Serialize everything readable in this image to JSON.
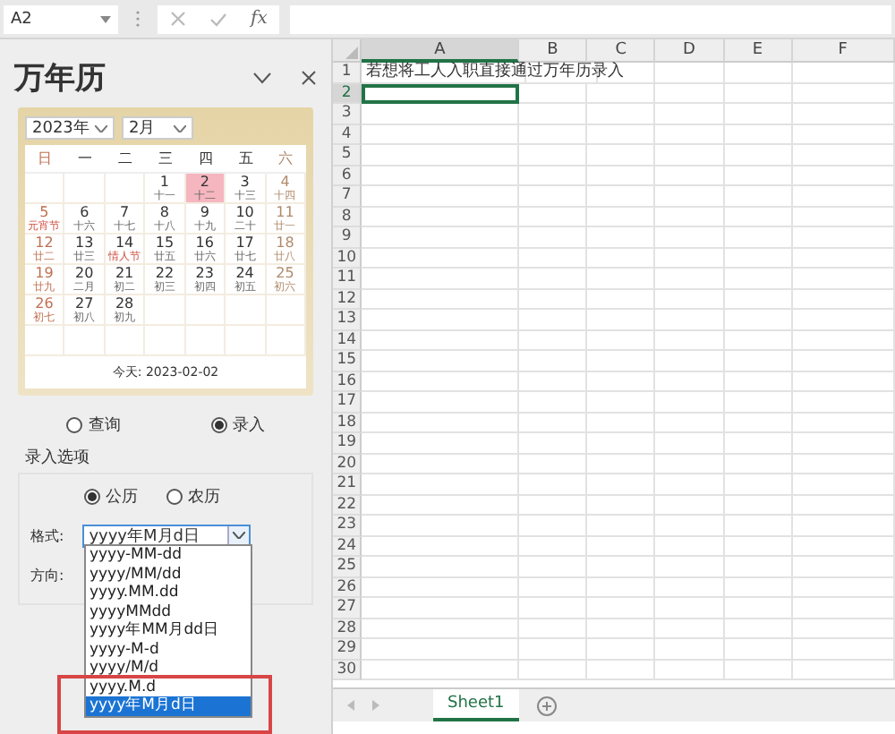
{
  "name_box": {
    "value": "A2"
  },
  "formula_bar": {
    "function_label": "fx"
  },
  "pane": {
    "title": "万年历",
    "year": "2023年",
    "month": "2月",
    "weekdays": [
      {
        "label": "日"
      },
      {
        "label": "一"
      },
      {
        "label": "二"
      },
      {
        "label": "三"
      },
      {
        "label": "四"
      },
      {
        "label": "五"
      },
      {
        "label": "六"
      }
    ],
    "weeks": [
      [
        {
          "day": "1",
          "lunar": "十一",
          "holiday": false,
          "selected": false
        },
        {
          "day": "2",
          "lunar": "十二",
          "holiday": false,
          "selected": true
        },
        {
          "day": "3",
          "lunar": "十三",
          "holiday": false,
          "selected": false
        },
        {
          "day": "4",
          "lunar": "十四",
          "holiday": false,
          "selected": false
        }
      ],
      [
        {
          "day": "5",
          "lunar": "元宵节",
          "holiday": true,
          "selected": false
        },
        {
          "day": "6",
          "lunar": "十六",
          "holiday": false,
          "selected": false
        },
        {
          "day": "7",
          "lunar": "十七",
          "holiday": false,
          "selected": false
        },
        {
          "day": "8",
          "lunar": "十八",
          "holiday": false,
          "selected": false
        },
        {
          "day": "9",
          "lunar": "十九",
          "holiday": false,
          "selected": false
        },
        {
          "day": "10",
          "lunar": "二十",
          "holiday": false,
          "selected": false
        },
        {
          "day": "11",
          "lunar": "廿一",
          "holiday": false,
          "selected": false
        }
      ],
      [
        {
          "day": "12",
          "lunar": "廿二",
          "holiday": false,
          "selected": false
        },
        {
          "day": "13",
          "lunar": "廿三",
          "holiday": false,
          "selected": false
        },
        {
          "day": "14",
          "lunar": "情人节",
          "holiday": true,
          "selected": false
        },
        {
          "day": "15",
          "lunar": "廿五",
          "holiday": false,
          "selected": false
        },
        {
          "day": "16",
          "lunar": "廿六",
          "holiday": false,
          "selected": false
        },
        {
          "day": "17",
          "lunar": "廿七",
          "holiday": false,
          "selected": false
        },
        {
          "day": "18",
          "lunar": "廿八",
          "holiday": false,
          "selected": false
        }
      ],
      [
        {
          "day": "19",
          "lunar": "廿九",
          "holiday": false,
          "selected": false
        },
        {
          "day": "20",
          "lunar": "二月",
          "holiday": false,
          "selected": false
        },
        {
          "day": "21",
          "lunar": "初二",
          "holiday": false,
          "selected": false
        },
        {
          "day": "22",
          "lunar": "初三",
          "holiday": false,
          "selected": false
        },
        {
          "day": "23",
          "lunar": "初四",
          "holiday": false,
          "selected": false
        },
        {
          "day": "24",
          "lunar": "初五",
          "holiday": false,
          "selected": false
        },
        {
          "day": "25",
          "lunar": "初六",
          "holiday": false,
          "selected": false
        }
      ],
      [
        {
          "day": "26",
          "lunar": "初七",
          "holiday": false,
          "selected": false
        },
        {
          "day": "27",
          "lunar": "初八",
          "holiday": false,
          "selected": false
        },
        {
          "day": "28",
          "lunar": "初九",
          "holiday": false,
          "selected": false
        }
      ]
    ],
    "today": "今天:  2023-02-02",
    "modes": [
      {
        "label": "查询",
        "selected": false
      },
      {
        "label": "录入",
        "selected": true
      }
    ],
    "options_title": "录入选项",
    "calendars": [
      {
        "label": "公历",
        "selected": true
      },
      {
        "label": "农历",
        "selected": false
      }
    ],
    "format_label": "格式:",
    "format_value": "yyyy年M月d日",
    "direction_label": "方向:",
    "format_options": [
      {
        "label": "yyyy-MM-dd",
        "selected": false
      },
      {
        "label": "yyyy/MM/dd",
        "selected": false
      },
      {
        "label": "yyyy.MM.dd",
        "selected": false
      },
      {
        "label": "yyyyMMdd",
        "selected": false
      },
      {
        "label": "yyyy年MM月dd日",
        "selected": false
      },
      {
        "label": "yyyy-M-d",
        "selected": false
      },
      {
        "label": "yyyy/M/d",
        "selected": false
      },
      {
        "label": "yyyy.M.d",
        "selected": false
      },
      {
        "label": "yyyy年M月d日",
        "selected": true
      }
    ]
  },
  "sheet": {
    "columns": [
      {
        "label": "A",
        "selected": true
      },
      {
        "label": "B",
        "selected": false
      },
      {
        "label": "C",
        "selected": false
      },
      {
        "label": "D",
        "selected": false
      },
      {
        "label": "E",
        "selected": false
      },
      {
        "label": "F",
        "selected": false
      }
    ],
    "rows": [
      {
        "number": "1",
        "selected": false,
        "text": "若想将工人入职直接通过万年历录入"
      },
      {
        "number": "2",
        "selected": true
      },
      {
        "number": "3",
        "selected": false
      },
      {
        "number": "4",
        "selected": false
      },
      {
        "number": "5",
        "selected": false
      },
      {
        "number": "6",
        "selected": false
      },
      {
        "number": "7",
        "selected": false
      },
      {
        "number": "8",
        "selected": false
      },
      {
        "number": "9",
        "selected": false
      },
      {
        "number": "10",
        "selected": false
      },
      {
        "number": "11",
        "selected": false
      },
      {
        "number": "12",
        "selected": false
      },
      {
        "number": "13",
        "selected": false
      },
      {
        "number": "14",
        "selected": false
      },
      {
        "number": "15",
        "selected": false
      },
      {
        "number": "16",
        "selected": false
      },
      {
        "number": "17",
        "selected": false
      },
      {
        "number": "18",
        "selected": false
      },
      {
        "number": "19",
        "selected": false
      },
      {
        "number": "20",
        "selected": false
      },
      {
        "number": "21",
        "selected": false
      },
      {
        "number": "22",
        "selected": false
      },
      {
        "number": "23",
        "selected": false
      },
      {
        "number": "24",
        "selected": false
      },
      {
        "number": "25",
        "selected": false
      },
      {
        "number": "26",
        "selected": false
      },
      {
        "number": "27",
        "selected": false
      },
      {
        "number": "28",
        "selected": false
      },
      {
        "number": "29",
        "selected": false
      },
      {
        "number": "30",
        "selected": false
      }
    ]
  },
  "sheet_tabs": [
    {
      "label": "Sheet1",
      "selected": true
    }
  ]
}
